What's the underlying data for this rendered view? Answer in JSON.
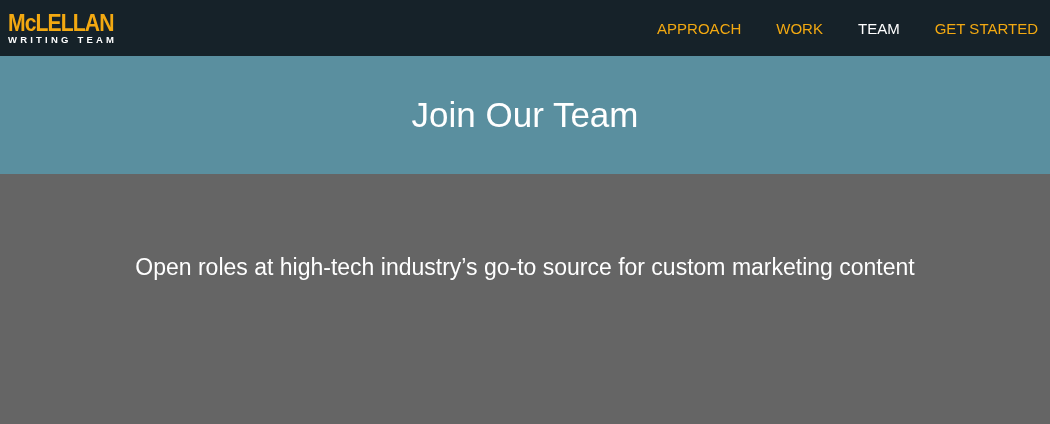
{
  "logo": {
    "name": "McLELLAN",
    "tagline": "WRITING TEAM"
  },
  "nav": [
    {
      "label": "APPROACH",
      "selected": false
    },
    {
      "label": "WORK",
      "selected": false
    },
    {
      "label": "TEAM",
      "selected": true
    },
    {
      "label": "GET STARTED",
      "selected": false
    }
  ],
  "hero": {
    "title": "Join Our Team"
  },
  "intro": {
    "text": "Open roles at high-tech industry’s go-to source for custom marketing content"
  }
}
